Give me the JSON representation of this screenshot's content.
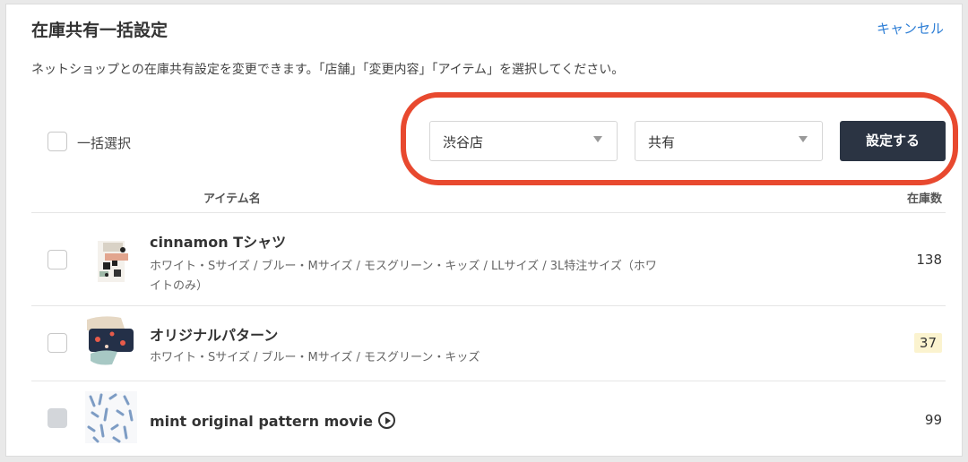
{
  "header": {
    "title": "在庫共有一括設定",
    "cancel_label": "キャンセル",
    "description": "ネットショップとの在庫共有設定を変更できます。「店舗」「変更内容」「アイテム」を選択してください。"
  },
  "toolbar": {
    "select_all_label": "一括選択",
    "store_select_value": "渋谷店",
    "change_select_value": "共有",
    "apply_label": "設定する",
    "highlight_color": "#e8492f"
  },
  "table": {
    "col_item_name": "アイテム名",
    "col_stock": "在庫数",
    "rows": [
      {
        "name": "cinnamon Tシャツ",
        "variants": "ホワイト・Sサイズ / ブルー・Mサイズ / モスグリーン・キッズ / LLサイズ / 3L特注サイズ（ホワイトのみ）",
        "stock": "138"
      },
      {
        "name": "オリジナルパターン",
        "variants": "ホワイト・Sサイズ / ブルー・Mサイズ / モスグリーン・キッズ",
        "stock": "37",
        "stock_highlight": "#fbf3cf"
      },
      {
        "name": "mint original pattern movie",
        "variants": "",
        "stock": "99",
        "icon": "play-icon"
      }
    ]
  }
}
